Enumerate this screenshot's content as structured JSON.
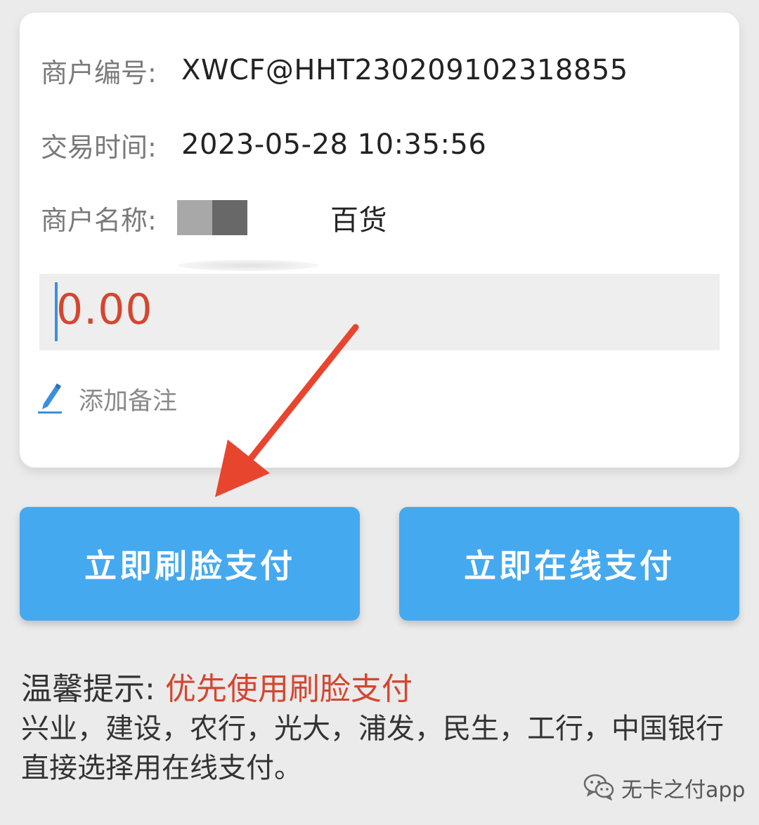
{
  "merchant": {
    "id_label": "商户编号:",
    "id_value": "XWCF@HHT230209102318855",
    "time_label": "交易时间:",
    "time_value": "2023-05-28 10:35:56",
    "name_label": "商户名称:",
    "name_value_visible": "百货"
  },
  "amount": {
    "value": "0.00"
  },
  "note": {
    "label": "添加备注",
    "icon": "pencil-icon"
  },
  "buttons": {
    "face_pay": "立即刷脸支付",
    "online_pay": "立即在线支付"
  },
  "tip": {
    "label": "温馨提示:",
    "highlight": "优先使用刷脸支付",
    "body": "兴业，建设，农行，光大，浦发，民生，工行，中国银行直接选择用在线支付。"
  },
  "watermark": {
    "text": "无卡之付app",
    "icon": "wechat-icon"
  },
  "colors": {
    "accent_blue": "#45a9f0",
    "highlight_red": "#d4462f",
    "arrow_red": "#e8452f",
    "background": "#ebebeb"
  }
}
